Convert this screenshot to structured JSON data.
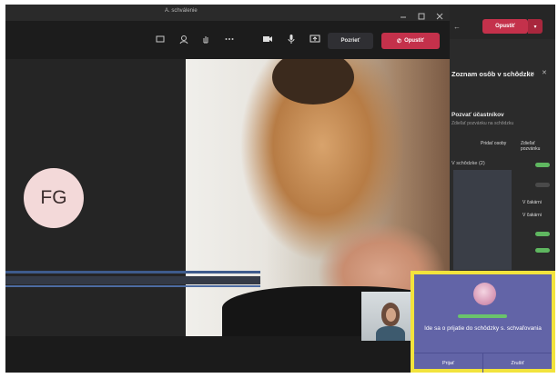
{
  "window": {
    "title": "A. schválenie"
  },
  "toolbar": {
    "reveal_label": "Pozrieť",
    "leave_label": "Opustiť"
  },
  "participant": {
    "initials": "FG"
  },
  "panel": {
    "leave_label": "Opustiť",
    "title": "Zoznam osôb v schôdzke",
    "section_title": "Pozvať účastníkov",
    "section_sub": "Zdieľať pozvánku na schôdzku",
    "tabs": [
      "Pridať osoby",
      "Zdieľať pozvánku"
    ],
    "group_label": "V schôdzke (2)",
    "statuses": [
      "V čakárni",
      "V čakárni"
    ]
  },
  "notification": {
    "message": "Ide sa o prijatie do schôdzky s. schvaľovania",
    "actions": [
      "Prijať",
      "Zrušiť"
    ]
  },
  "colors": {
    "leave": "#c4314b",
    "notification_bg": "#6264a7",
    "notification_border": "#f2e33c",
    "avatar_bg": "#f3d9d9"
  }
}
